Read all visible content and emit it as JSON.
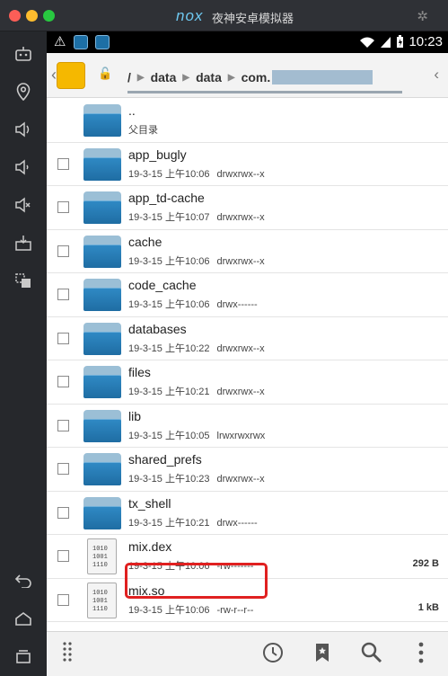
{
  "window": {
    "brand": "nox",
    "title": "夜神安卓模拟器"
  },
  "status": {
    "time": "10:23"
  },
  "toolbar": {
    "crumbs": [
      "/",
      "data",
      "data",
      "com."
    ]
  },
  "files": [
    {
      "name": "..",
      "sub": "父目录",
      "perm": "",
      "size": "",
      "type": "folder"
    },
    {
      "name": "app_bugly",
      "sub": "19-3-15 上午10:06",
      "perm": "drwxrwx--x",
      "size": "",
      "type": "folder"
    },
    {
      "name": "app_td-cache",
      "sub": "19-3-15 上午10:07",
      "perm": "drwxrwx--x",
      "size": "",
      "type": "folder"
    },
    {
      "name": "cache",
      "sub": "19-3-15 上午10:06",
      "perm": "drwxrwx--x",
      "size": "",
      "type": "folder"
    },
    {
      "name": "code_cache",
      "sub": "19-3-15 上午10:06",
      "perm": "drwx------",
      "size": "",
      "type": "folder"
    },
    {
      "name": "databases",
      "sub": "19-3-15 上午10:22",
      "perm": "drwxrwx--x",
      "size": "",
      "type": "folder"
    },
    {
      "name": "files",
      "sub": "19-3-15 上午10:21",
      "perm": "drwxrwx--x",
      "size": "",
      "type": "folder"
    },
    {
      "name": "lib",
      "sub": "19-3-15 上午10:05",
      "perm": "lrwxrwxrwx",
      "size": "",
      "type": "folder"
    },
    {
      "name": "shared_prefs",
      "sub": "19-3-15 上午10:23",
      "perm": "drwxrwx--x",
      "size": "",
      "type": "folder"
    },
    {
      "name": "tx_shell",
      "sub": "19-3-15 上午10:21",
      "perm": "drwx------",
      "size": "",
      "type": "folder"
    },
    {
      "name": "mix.dex",
      "sub": "19-3-15 上午10:06",
      "perm": "-rw-------",
      "size": "292 B",
      "type": "binary"
    },
    {
      "name": "mix.so",
      "sub": "19-3-15 上午10:06",
      "perm": "-rw-r--r--",
      "size": "1 kB",
      "type": "binary"
    }
  ],
  "binary_glyph": [
    "1010",
    "1001",
    "1110"
  ]
}
